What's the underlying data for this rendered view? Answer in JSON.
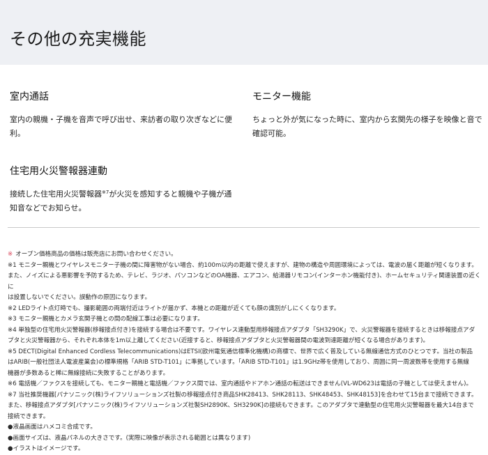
{
  "header": {
    "title": "その他の充実機能"
  },
  "features": [
    {
      "title": "室内通話",
      "description": "室内の親機・子機を音声で呼び出せ、来訪者の取り次ぎなどに便利。"
    },
    {
      "title": "モニター機能",
      "description_lines": [
        "ちょっと外が気になった時に、室内から玄関先の様子を映像と音で",
        "確認可能。"
      ]
    },
    {
      "title": "住宅用火災警報器連動",
      "description_before": "接続した住宅用火災警報器",
      "description_sup": "※7",
      "description_after": "が火災を感知すると親機や子機が通",
      "description_line2": "知音などでお知らせ。"
    }
  ],
  "notes": {
    "mark": "※",
    "lines": [
      "オープン価格商品の価格は販売店にお問い合わせください。",
      "※1 モニター親機とワイヤレスモニター子機の間に障害物がない場合、約100m以内の距離で使えますが、建物の構造や周囲環境によっては、電波の届く距離が短くなります。",
      "また、ノイズによる悪影響を予防するため、テレビ、ラジオ、パソコンなどのOA機器、エアコン、給湯器リモコン(インターホン機能付き)、ホームセキュリティ関連装置の近くに",
      "は設置しないでください。誤動作の原因になります。",
      "※2 LEDライト点灯時でも、撮影範囲の両端付近はライトが届かず、本機との距離が近くても顔の識別がしにくくなります。",
      "※3 モニター親機とカメラ玄関子機との間の配線工事は必要になります。",
      "※4 単独型の住宅用火災警報器(移報接点付き)を接続する場合は不要です。ワイヤレス連動型用移報接点アダプタ「SH3290K」で、火災警報器を接続するときは移報接点アダ",
      "プタと火災警報器から、それぞれ本体を1m以上離してください(近接すると、移報接点アダプタと火災警報器間の電波到達距離が短くなる場合があります)。",
      "※5 DECT(Digital Enhanced Cordless Telecommunications)はETSI(欧州電気通信標準化機構)の商標で、世界で広く普及している無線通信方式のひとつです。当社の製品",
      "はARIB(一般社団法人電波産業会)の標準規格「ARIB STD-T101」に準拠しています。「ARIB STD-T101」は1.9GHz帯を使用しており、周囲に同一周波数帯を使用する無線",
      "機器が多数あると稀に無線接続に失敗することがあります。",
      "※6 電話機／ファクスを接続しても、モニター親機と電話機／ファクス間では、室内通話やドアホン通話の転送はできません(VL-WD623は電話の子機としては使えません)。",
      "※7 当社推奨機器[パナソニック(株)ライフソリューションズ社製の移報接点付き商品SHK28413、SHK28113、SHK48453、SHK48153]を合わせて15台まで接続できます。",
      "また、移報接点アダプタ[パナソニック(株)ライフソリューションズ社製SH2890K、SH3290K]の接続もできます。このアダプタで連動型の住宅用火災警報器を最大14台まで",
      "接続できます。",
      "●液晶画面はハメコミ合成です。",
      "●画面サイズは、液晶パネルの大きさです。(実際に映像が表示される範囲とは異なります)",
      "●イラストはイメージです。"
    ]
  }
}
